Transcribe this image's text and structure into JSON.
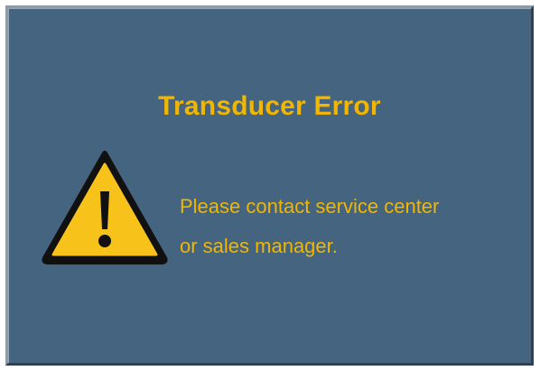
{
  "dialog": {
    "title": "Transducer Error",
    "message_line1": "Please contact service center",
    "message_line2": "or sales manager.",
    "icon": "warning-triangle-icon"
  },
  "colors": {
    "background": "#44647f",
    "text_accent": "#f2b600",
    "icon_fill": "#f7c21a",
    "icon_outline": "#111111"
  }
}
